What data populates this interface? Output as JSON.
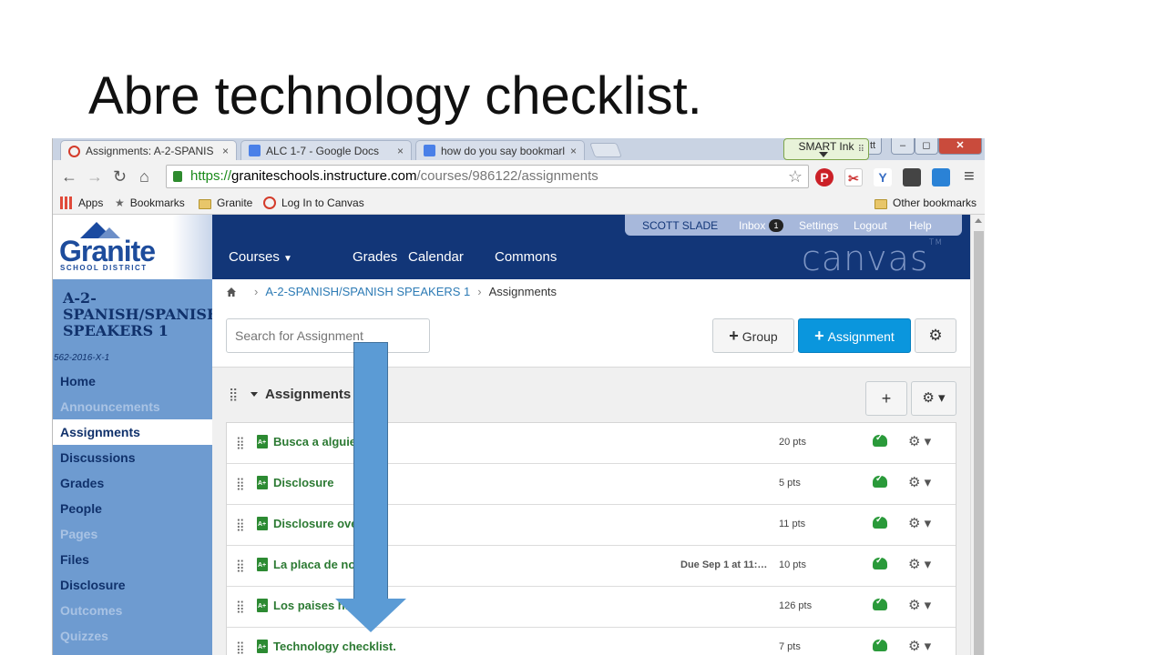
{
  "slide": {
    "title": "Abre technology checklist."
  },
  "browser": {
    "tabs": [
      {
        "title": "Assignments: A-2-SPANIS",
        "close": "×"
      },
      {
        "title": "ALC 1-7 - Google Docs",
        "close": "×"
      },
      {
        "title": "how do you say bookmarl",
        "close": "×"
      }
    ],
    "smart_ink": "SMART Ink",
    "smart_ink_grip": "⠿",
    "window_controls": {
      "prev": "tt",
      "minimize": "–",
      "restore": "◻",
      "close": "✕"
    },
    "nav": {
      "back": "←",
      "forward": "→",
      "reload": "↻",
      "home": "⌂"
    },
    "url": {
      "scheme": "https://",
      "host": "graniteschools.instructure.com",
      "path": "/courses/986122/assignments"
    },
    "star": "☆",
    "menu": "≡",
    "bookmarks": {
      "apps": "Apps",
      "bookmarks": "Bookmarks",
      "granite": "Granite",
      "login": "Log In to Canvas",
      "other": "Other bookmarks"
    }
  },
  "canvas": {
    "logo": {
      "text": "Granite",
      "subtitle": "SCHOOL DISTRICT"
    },
    "user_menu": {
      "name": "SCOTT SLADE",
      "inbox": "Inbox",
      "inbox_count": "1",
      "settings": "Settings",
      "logout": "Logout",
      "help": "Help"
    },
    "main_nav": {
      "courses": "Courses",
      "grades": "Grades",
      "calendar": "Calendar",
      "commons": "Commons"
    },
    "brand": "canvas",
    "brand_tm": "TM",
    "course": {
      "title_line1": "A-2-",
      "title_line2": "SPANISH/SPANISH",
      "title_line3": "SPEAKERS 1",
      "term": "562-2016-X-1"
    },
    "course_nav": [
      {
        "label": "Home"
      },
      {
        "label": "Announcements"
      },
      {
        "label": "Assignments"
      },
      {
        "label": "Discussions"
      },
      {
        "label": "Grades"
      },
      {
        "label": "People"
      },
      {
        "label": "Pages"
      },
      {
        "label": "Files"
      },
      {
        "label": "Disclosure"
      },
      {
        "label": "Outcomes"
      },
      {
        "label": "Quizzes"
      }
    ],
    "breadcrumb": {
      "course": "A-2-SPANISH/SPANISH SPEAKERS 1",
      "page": "Assignments"
    },
    "search": {
      "placeholder": "Search for Assignment"
    },
    "buttons": {
      "group": "Group",
      "assignment": "Assignment",
      "plus": "+",
      "gear": "⚙"
    },
    "group": {
      "title": "Assignments",
      "add": "+",
      "gear": "⚙ ▾"
    },
    "handle": "⣿",
    "assignments": [
      {
        "name": "Busca a alguien",
        "due": "",
        "points": "20 pts",
        "gear": "⚙ ▾"
      },
      {
        "name": "Disclosure",
        "due": "",
        "points": "5 pts",
        "gear": "⚙ ▾"
      },
      {
        "name": "Disclosure overview",
        "due": "",
        "points": "11 pts",
        "gear": "⚙ ▾"
      },
      {
        "name": "La placa de nombre",
        "due": "Due Sep 1 at 11:…",
        "points": "10 pts",
        "gear": "⚙ ▾"
      },
      {
        "name": "Los paises hispanos",
        "due": "",
        "points": "126 pts",
        "gear": "⚙ ▾"
      },
      {
        "name": "Technology checklist.",
        "due": "",
        "points": "7 pts",
        "gear": "⚙ ▾"
      }
    ]
  },
  "colors": {
    "nav_blue": "#123678",
    "sidebar_blue": "#6e9bd0",
    "primary_button": "#0a96dd",
    "assignment_green": "#2c7a33",
    "arrow": "#5b9bd5"
  }
}
